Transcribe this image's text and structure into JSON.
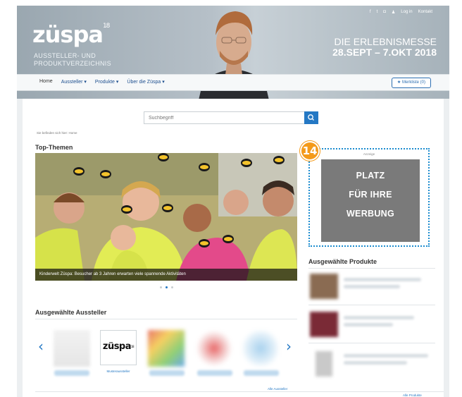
{
  "header": {
    "logo": "züspa",
    "logo_sup": "18",
    "subtitle_line1": "AUSSTELLER- UND",
    "subtitle_line2": "PRODUKTVERZEICHNIS",
    "claim_line1": "DIE ERLEBNISMESSE",
    "claim_line2": "28.SEPT – 7.OKT 2018",
    "utility": [
      "Log in",
      "Kontakt"
    ]
  },
  "nav": {
    "items": [
      "Home",
      "Aussteller",
      "Produkte",
      "Über die Züspa"
    ],
    "watchlist": "Merkliste (0)"
  },
  "search": {
    "placeholder": "Suchbegriff"
  },
  "breadcrumb": "Sie befinden sich hier:  Home",
  "top_themes": {
    "heading": "Top-Themen",
    "caption": "Kinderwelt Züspa: Besucher ab 3 Jahren erwarten viele spannende Aktivitäten"
  },
  "ad": {
    "badge": "14",
    "label": "Anzeige",
    "line1": "PLATZ",
    "line2": "FÜR IHRE",
    "line3": "WERBUNG"
  },
  "products": {
    "heading": "Ausgewählte Produkte",
    "more": "Alle Produkte"
  },
  "exhibitors": {
    "heading": "Ausgewählte Aussteller",
    "logo": "züspa",
    "logo_sup": "18",
    "logo_name": "Musteraussteller",
    "more": "Alle Aussteller"
  },
  "colors": {
    "brand_blue": "#2478c4",
    "badge_orange": "#f49a19",
    "ad_gray": "#7a7a7a"
  }
}
